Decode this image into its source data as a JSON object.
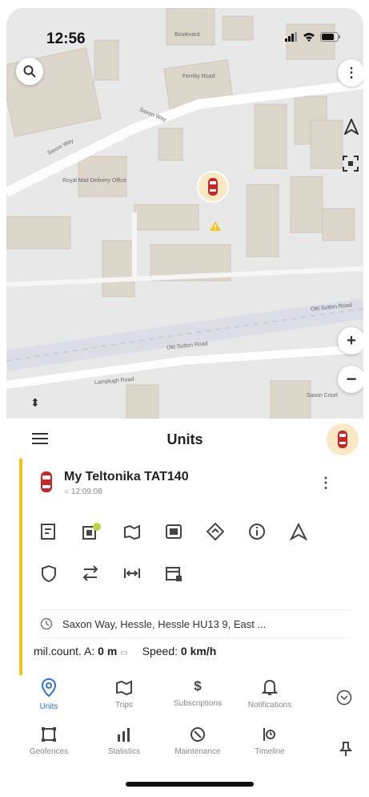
{
  "status_bar": {
    "time": "12:56"
  },
  "map": {
    "street_labels": [
      "Saxon Way",
      "Saxon Way",
      "Royal Mail Delivery Office",
      "Ferriby Road",
      "Boulevard",
      "Old Sutton Road",
      "Old Sutton Road",
      "Lamplugh Road",
      "Saxon Court"
    ],
    "search_icon": "search-icon",
    "marker_color": "#c62828",
    "warning_color": "#f0c419"
  },
  "panel": {
    "title": "Units",
    "unit": {
      "name": "My Teltonika TAT140",
      "time": "12:09:08",
      "accent": "#f0c419",
      "address": "Saxon Way, Hessle, Hessle HU13 9, East ...",
      "mileage_label": "mil.count. A:",
      "mileage_value": "0 m",
      "speed_label": "Speed:",
      "speed_value": "0 km/h"
    },
    "action_icons_row1": [
      "report-icon",
      "unit-badge-icon",
      "trips-icon",
      "gallery-icon",
      "navigate-icon",
      "info-icon",
      "triangle-icon"
    ],
    "action_icons_row2": [
      "shield-icon",
      "commands-icon",
      "distance-icon",
      "calendar-icon"
    ]
  },
  "nav": {
    "row1": [
      {
        "label": "Units",
        "active": true
      },
      {
        "label": "Trips"
      },
      {
        "label": "Subscriptions"
      },
      {
        "label": "Notifications"
      }
    ],
    "row2": [
      {
        "label": "Geofences"
      },
      {
        "label": "Statistics"
      },
      {
        "label": "Maintenance"
      },
      {
        "label": "Timeline"
      }
    ],
    "active_color": "#2f6fd6"
  }
}
